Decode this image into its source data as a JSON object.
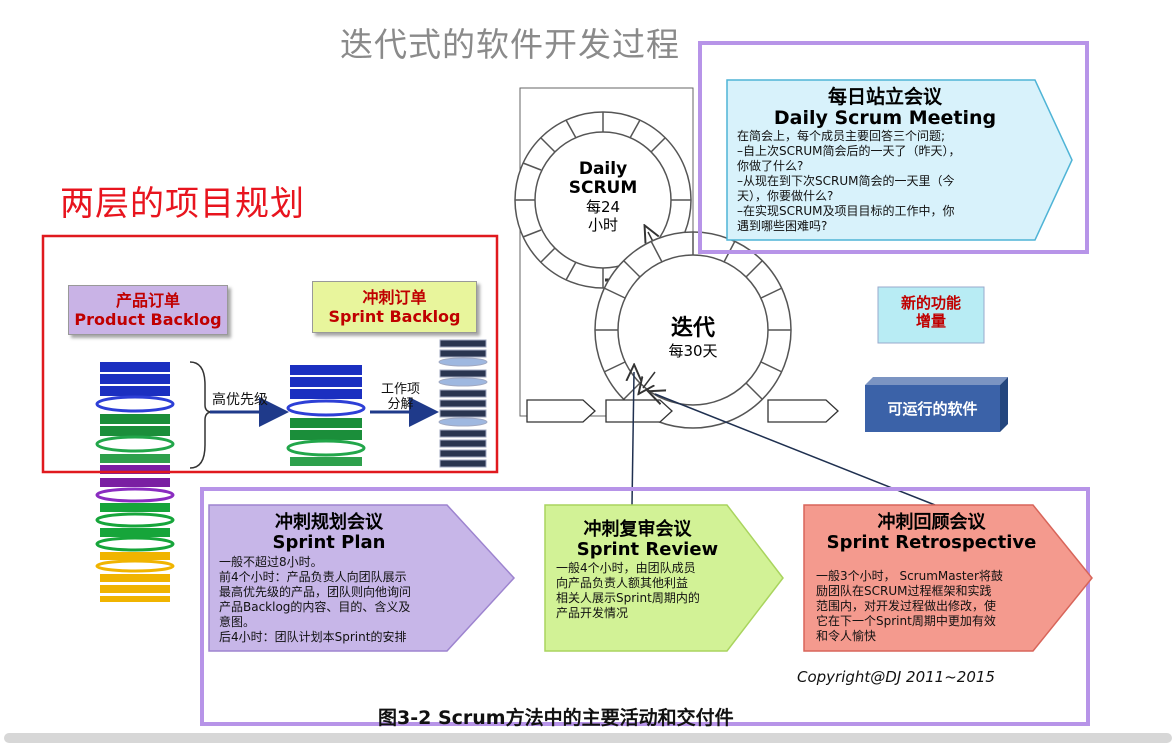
{
  "title": "迭代式的软件开发过程",
  "two_level_label": "两层的项目规划",
  "product_backlog": {
    "cn": "产品订单",
    "en": "Product Backlog"
  },
  "sprint_backlog": {
    "cn": "冲刺订单",
    "en": "Sprint Backlog"
  },
  "high_priority": "高优先级",
  "decompose": {
    "line1": "工作项",
    "line2": "分解"
  },
  "daily_scrum": {
    "line1": "Daily",
    "line2": "SCRUM",
    "line3": "每24",
    "line4": "小时"
  },
  "daily_meeting": {
    "cn": "每日站立会议",
    "en": "Daily Scrum Meeting",
    "lines": [
      "在简会上，每个成员主要回答三个问题;",
      "–自上次SCRUM简会后的一天了（昨天），",
      "你做了什么?",
      "–从现在到下次SCRUM简会的一天里（今",
      "天），你要做什么?",
      "–在实现SCRUM及项目目标的工作中，你",
      "遇到哪些困难吗?"
    ]
  },
  "iteration": {
    "cn": "迭代",
    "sub": "每30天"
  },
  "new_increment": {
    "line1": "新的功能",
    "line2": "增量"
  },
  "runnable": "可运行的软件",
  "sprint_plan": {
    "cn": "冲刺规划会议",
    "en": "Sprint Plan",
    "lines": [
      "一般不超过8小时。",
      "前4个小时：产品负责人向团队展示",
      "最高优先级的产品，团队则向他询问",
      "产品Backlog的内容、目的、含义及",
      "意图。",
      "后4小时：团队计划本Sprint的安排"
    ]
  },
  "sprint_review": {
    "cn": "冲刺复审会议",
    "en": "Sprint Review",
    "lines": [
      "一般4个小时，由团队成员",
      "向产品负责人额其他利益",
      "相关人展示Sprint周期内的",
      "产品开发情况"
    ]
  },
  "sprint_retro": {
    "cn": "冲刺回顾会议",
    "en": "Sprint Retrospective",
    "lines": [
      "一般3个小时，  ScrumMaster将鼓",
      "励团队在SCRUM过程框架和实践",
      "范围内，对开发过程做出修改，使",
      "它在下一个Sprint周期中更加有效",
      "和令人愉快"
    ]
  },
  "copyright": "Copyright@DJ  2011~2015",
  "caption": "图3-2 Scrum方法中的主要活动和交付件",
  "colors": {
    "plan_fill": "#c7b6e8",
    "review_fill": "#d2f296",
    "retro_fill": "#f49a8e",
    "daily_fill": "#d8f2fb",
    "highlight_purple": "#b794e8",
    "highlight_red": "#e0191e"
  }
}
